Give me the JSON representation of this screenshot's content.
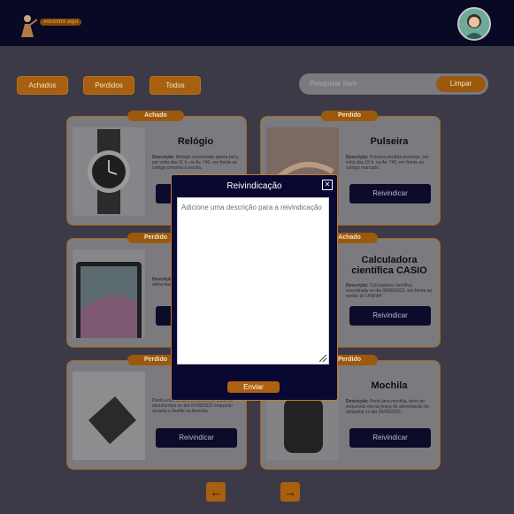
{
  "header": {
    "logo_text": "encontre aqui"
  },
  "filters": [
    {
      "label": "Achados"
    },
    {
      "label": "Perdidos"
    },
    {
      "label": "Todos"
    }
  ],
  "search": {
    "placeholder": "Pesquisar Item",
    "clear_label": "Limpar"
  },
  "cards": [
    {
      "badge": "Achado",
      "title": "Relógio",
      "desc_label": "Descrição:",
      "desc": "Relógio encontrado quinta-feira, por volta das 11 h, na Av. 740, em frente ao colégio próximo à escola.",
      "button": "Reivindicar"
    },
    {
      "badge": "Perdido",
      "title": "Pulseira",
      "desc_label": "Descrição:",
      "desc": "Pulseira perdida domingo, por volta das 15 h, na Av. 740, em frente ao colégio marcado.",
      "button": "Reivindicar"
    },
    {
      "badge": "Perdido",
      "title": "T",
      "desc_label": "Descrição:",
      "desc": "Tablet esquecido na praça de alimentação. Fa...",
      "button": "Reivindicar"
    },
    {
      "badge": "Achado",
      "title": "Calculadora científica CASIO",
      "desc_label": "Descrição:",
      "desc": "Calculadora científica encontrada no dia 08/08/2022, em frente ao portão do UNIFAP.",
      "button": "Reivindicar"
    },
    {
      "badge": "Perdido",
      "title": "",
      "desc_label": "",
      "desc": "Perdi a minha carteira contendo todos os documentos no dia 07/08/2022 enquanto assistia o desfile na Avenida.",
      "button": "Reivindicar"
    },
    {
      "badge": "Perdido",
      "title": "Mochila",
      "desc_label": "Descrição:",
      "desc": "Perdi uma mochila, devo ter esquecido ela na praça de alimentação do shopping no dia 05/08/2022.",
      "button": "Reivindicar"
    }
  ],
  "pagination": {
    "prev_icon": "arrow-left-icon",
    "next_icon": "arrow-right-icon"
  },
  "modal": {
    "title": "Reivindicação",
    "placeholder": "Adicione uma descrição para a reivindicação",
    "send_label": "Enviar"
  }
}
